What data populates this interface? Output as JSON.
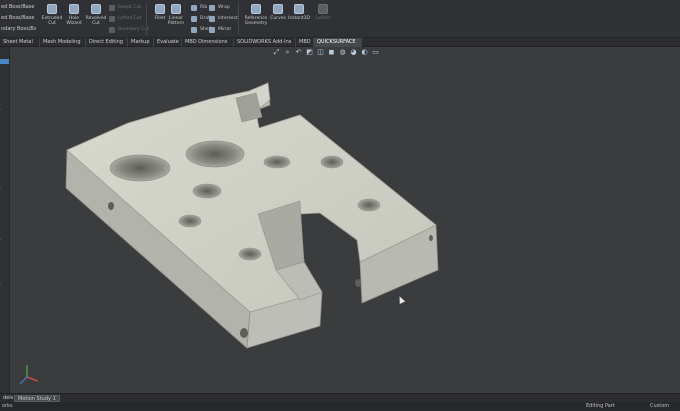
{
  "ribbon": {
    "left_items": [
      "ed Boss/Base",
      "ed Boss/Base",
      "ndary Boss/Base"
    ],
    "buttons": [
      {
        "label": "Extruded Cut",
        "dim": false
      },
      {
        "label": "Hole Wizard",
        "dim": false
      },
      {
        "label": "Revolved Cut",
        "dim": false
      },
      {
        "label": "Fillet",
        "dim": false
      },
      {
        "label": "Linear Pattern",
        "dim": false
      },
      {
        "label": "Reference Geometry",
        "dim": false
      },
      {
        "label": "Curves",
        "dim": false
      },
      {
        "label": "Instant3D",
        "dim": false
      },
      {
        "label": "Lofted",
        "dim": true
      }
    ],
    "small_items": [
      "Swept Cut",
      "Lofted Cut",
      "Boundary Cut",
      "Rib",
      "Draft",
      "Shell",
      "Wrap",
      "Intersect",
      "Mirror"
    ]
  },
  "tabs": [
    "Sheet Metal",
    "Mesh Modeling",
    "Direct Editing",
    "Markup",
    "Evaluate",
    "MBD Dimensions",
    "SOLIDWORKS Add-Ins",
    "MBD",
    "QUICKSURFACE"
  ],
  "active_tab": "QUICKSURFACE",
  "hud_icons": [
    "zoom-to-fit-icon",
    "zoom-area-icon",
    "previous-view-icon",
    "section-view-icon",
    "view-orientation-icon",
    "display-style-icon",
    "hide-show-icon",
    "appearance-icon",
    "scene-icon",
    "view-settings-icon"
  ],
  "bottom_tabs": [
    "dels",
    "Motion Study 1"
  ],
  "active_bottom_tab": "Motion Study 1",
  "status": {
    "left": "orks",
    "middle": "Editing Part",
    "right": "Custom"
  },
  "colors": {
    "background": "#3b3c3e",
    "part": "#cfd0c5",
    "accent": "#4a86c5"
  }
}
